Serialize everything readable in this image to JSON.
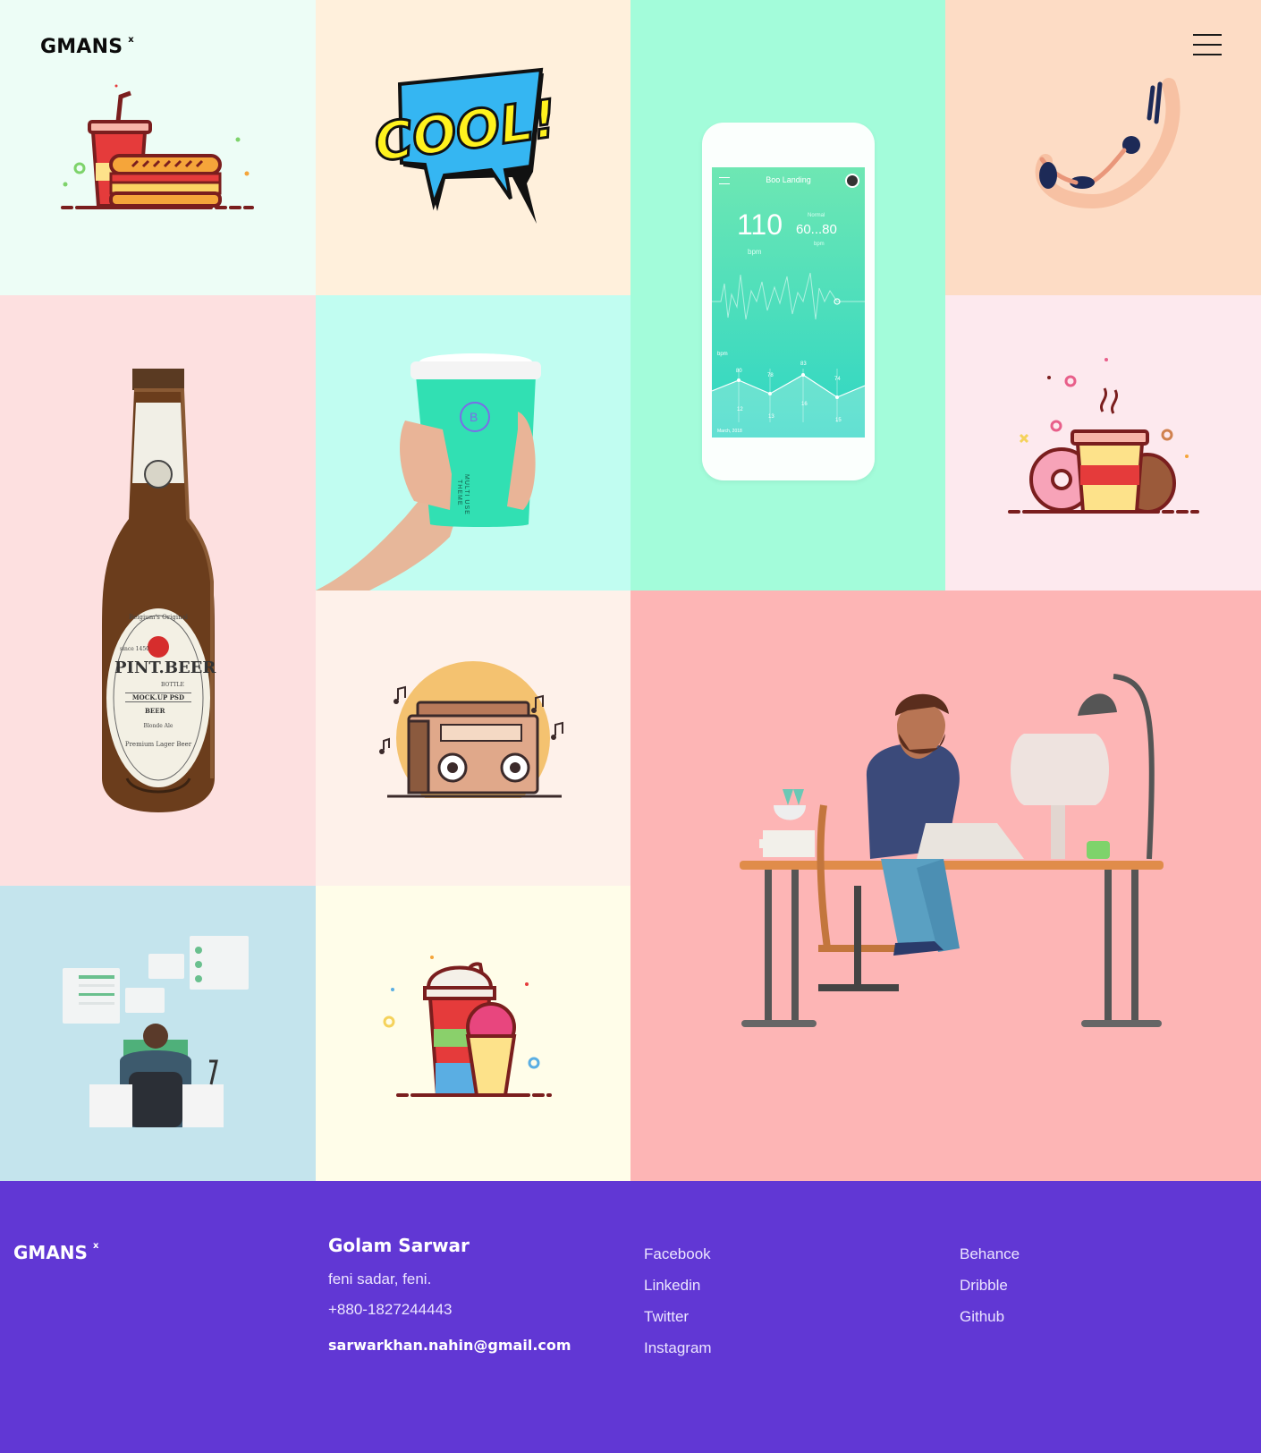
{
  "header": {
    "logo": "GMANS",
    "logo_mark": "x",
    "menu_icon": "hamburger-menu-icon"
  },
  "portfolio": {
    "tiles": [
      {
        "name": "drink-and-sandwich-illustration",
        "bg": "#edfdf6"
      },
      {
        "name": "cool-speech-bubble-illustration",
        "bg": "#fff0dc",
        "text": "COOL!"
      },
      {
        "name": "heart-rate-app-mockup",
        "bg": "#a3fcda"
      },
      {
        "name": "diving-woman-illustration",
        "bg": "#fddcc5"
      },
      {
        "name": "beer-bottle-mockup",
        "bg": "#fde0e0"
      },
      {
        "name": "coffee-cup-mockup",
        "bg": "#c1fdf1"
      },
      {
        "name": "coffee-and-donuts-illustration",
        "bg": "#fde9ee"
      },
      {
        "name": "boombox-illustration",
        "bg": "#fef1ea"
      },
      {
        "name": "man-at-desk-illustration",
        "bg": "#fdb5b5"
      },
      {
        "name": "office-chat-illustration",
        "bg": "#c4e4ed"
      },
      {
        "name": "drink-and-ice-cream-illustration",
        "bg": "#fffde9"
      }
    ],
    "app_mockup": {
      "title": "Boo Landing",
      "bpm": "110",
      "bpm_unit": "bpm",
      "normal_label": "Normal",
      "range": "60...80",
      "range_unit": "bpm",
      "chart_label": "bpm",
      "points": [
        "80",
        "78",
        "83",
        "74",
        "12",
        "13",
        "16",
        "15"
      ],
      "date": "March, 2018"
    },
    "beer_label": {
      "brand": "PINT.BEER",
      "top": "Belgium's Original",
      "since": "since 1450",
      "bottle": "BOTTLE",
      "mockup": "MOCK.UP PSD",
      "beer": "BEER",
      "style": "Blonde Ale",
      "bottom": "Premium Lager Beer"
    },
    "cup_label": {
      "letter": "B",
      "line1": "MULTI USE",
      "line2": "THEME"
    }
  },
  "footer": {
    "logo": "GMANS",
    "logo_mark": "x",
    "name": "Golam Sarwar",
    "address": "feni sadar, feni.",
    "phone": "+880-1827244443",
    "email": "sarwarkhan.nahin@gmail.com",
    "social_col1": [
      "Facebook",
      "Linkedin",
      "Twitter",
      "Instagram"
    ],
    "social_col2": [
      "Behance",
      "Dribble",
      "Github"
    ]
  },
  "colors": {
    "footer_bg": "#6137d4",
    "accent": "#ffffff"
  }
}
